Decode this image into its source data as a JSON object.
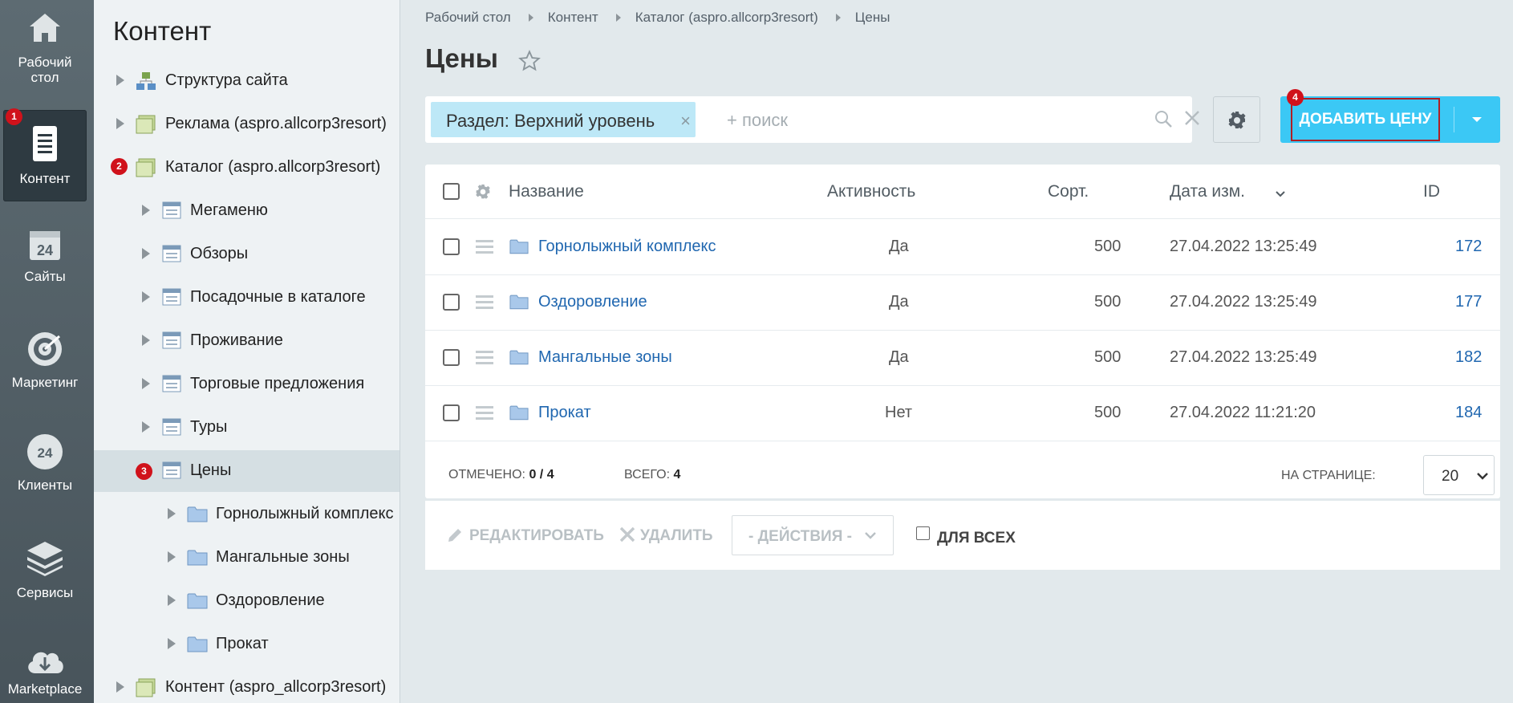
{
  "leftmenu": {
    "items": [
      {
        "label": "Рабочий стол",
        "icon": "home-icon"
      },
      {
        "label": "Контент",
        "icon": "document-icon",
        "badge": "1"
      },
      {
        "label": "Сайты",
        "icon": "calendar-24-icon"
      },
      {
        "label": "Маркетинг",
        "icon": "target-icon"
      },
      {
        "label": "Клиенты",
        "icon": "cloud-24-icon"
      },
      {
        "label": "Сервисы",
        "icon": "layers-icon"
      },
      {
        "label": "Marketplace",
        "icon": "cloud-download-icon"
      }
    ]
  },
  "tree": {
    "title": "Контент",
    "items": [
      {
        "label": "Структура сайта",
        "icon": "structure-icon"
      },
      {
        "label": "Реклама (aspro.allcorp3resort)",
        "icon": "iblock-type-icon"
      },
      {
        "label": "Каталог (aspro.allcorp3resort)",
        "icon": "iblock-type-icon",
        "badge": "2"
      },
      {
        "label": "Мегаменю",
        "icon": "iblock-icon"
      },
      {
        "label": "Обзоры",
        "icon": "iblock-icon"
      },
      {
        "label": "Посадочные в каталоге",
        "icon": "iblock-icon"
      },
      {
        "label": "Проживание",
        "icon": "iblock-icon"
      },
      {
        "label": "Торговые предложения",
        "icon": "iblock-icon"
      },
      {
        "label": "Туры",
        "icon": "iblock-icon"
      },
      {
        "label": "Цены",
        "icon": "iblock-icon",
        "badge": "3",
        "selected": true
      },
      {
        "label": "Горнолыжный комплекс",
        "icon": "folder-icon"
      },
      {
        "label": "Мангальные зоны",
        "icon": "folder-icon"
      },
      {
        "label": "Оздоровление",
        "icon": "folder-icon"
      },
      {
        "label": "Прокат",
        "icon": "folder-icon"
      },
      {
        "label": "Контент (aspro_allcorp3resort)",
        "icon": "iblock-type-icon"
      }
    ]
  },
  "breadcrumbs": [
    "Рабочий стол",
    "Контент",
    "Каталог (aspro.allcorp3resort)",
    "Цены"
  ],
  "page_title": "Цены",
  "filter": {
    "chip": "Раздел: Верхний уровень",
    "chip_close": "×",
    "placeholder": "+ поиск"
  },
  "add_button": {
    "label": "ДОБАВИТЬ ЦЕНУ",
    "badge": "4"
  },
  "grid": {
    "columns": [
      "Название",
      "Активность",
      "Сорт.",
      "Дата изм.",
      "ID"
    ],
    "rows": [
      {
        "name": "Горнолыжный комплекс",
        "active": "Да",
        "sort": "500",
        "date": "27.04.2022 13:25:49",
        "id": "172"
      },
      {
        "name": "Оздоровление",
        "active": "Да",
        "sort": "500",
        "date": "27.04.2022 13:25:49",
        "id": "177"
      },
      {
        "name": "Мангальные зоны",
        "active": "Да",
        "sort": "500",
        "date": "27.04.2022 13:25:49",
        "id": "182"
      },
      {
        "name": "Прокат",
        "active": "Нет",
        "sort": "500",
        "date": "27.04.2022 11:21:20",
        "id": "184"
      }
    ],
    "footer": {
      "checked_label": "ОТМЕЧЕНО:",
      "checked_value": "0 / 4",
      "total_label": "ВСЕГО:",
      "total_value": "4",
      "per_page_label": "НА СТРАНИЦЕ:",
      "per_page_value": "20"
    }
  },
  "actionbar": {
    "edit": "РЕДАКТИРОВАТЬ",
    "delete": "УДАЛИТЬ",
    "actions": "- ДЕЙСТВИЯ -",
    "for_all": "ДЛЯ ВСЕХ"
  },
  "colors": {
    "accent": "#3bc8f5",
    "badge": "#d0121b",
    "link": "#2067b0",
    "highlight_border": "#b01e23"
  }
}
